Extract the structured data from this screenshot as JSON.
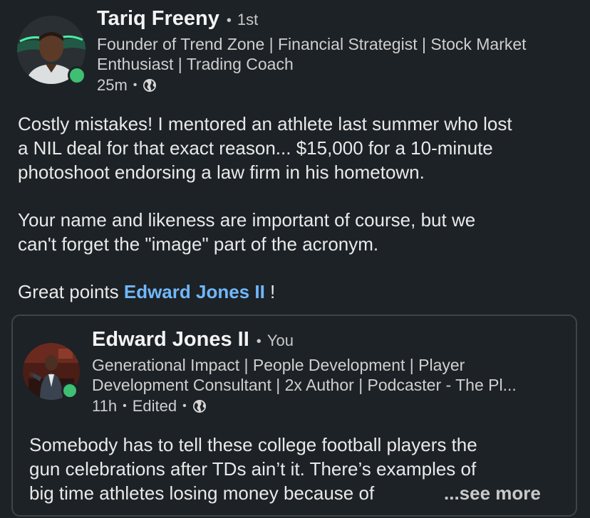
{
  "post": {
    "author": {
      "name": "Tariq Freeny",
      "separator": "•",
      "degree": "1st",
      "headline_line1": "Founder of Trend Zone | Financial Strategist | Stock Market",
      "headline_line2": "Enthusiast | Trading Coach",
      "time": "25m",
      "meta_separator": "•",
      "visibility_icon": "globe-icon",
      "online": true
    },
    "body": {
      "p1_line1": "Costly mistakes! I mentored an athlete last summer who lost",
      "p1_line2": "a NIL deal for that exact reason... $15,000 for a 10-minute",
      "p1_line3": "photoshoot endorsing a law firm in his hometown.",
      "p2_line1": "Your name and likeness are important of course, but we",
      "p2_line2": "can't forget the \"image\" part of the acronym.",
      "p3_prefix": "Great points ",
      "p3_mention": "Edward Jones II",
      "p3_suffix": " !"
    }
  },
  "quoted": {
    "author": {
      "name": "Edward Jones II",
      "separator": "•",
      "relation": "You",
      "headline_line1": "Generational Impact | People Development | Player",
      "headline_line2": "Development Consultant | 2x Author | Podcaster - The Pl...",
      "time": "11h",
      "meta_separator": "•",
      "edited": "Edited",
      "meta_separator2": "•",
      "visibility_icon": "globe-icon",
      "online": true
    },
    "body": {
      "line1": "Somebody has to tell these college football players the",
      "line2": "gun celebrations after TDs ain’t it. There’s examples of",
      "line3": "big time athletes losing money because of",
      "see_more": "...see more"
    }
  },
  "colors": {
    "background": "#1d2226",
    "mention": "#71b7fb",
    "online": "#3fbf72",
    "card_border": "#3e4449"
  }
}
